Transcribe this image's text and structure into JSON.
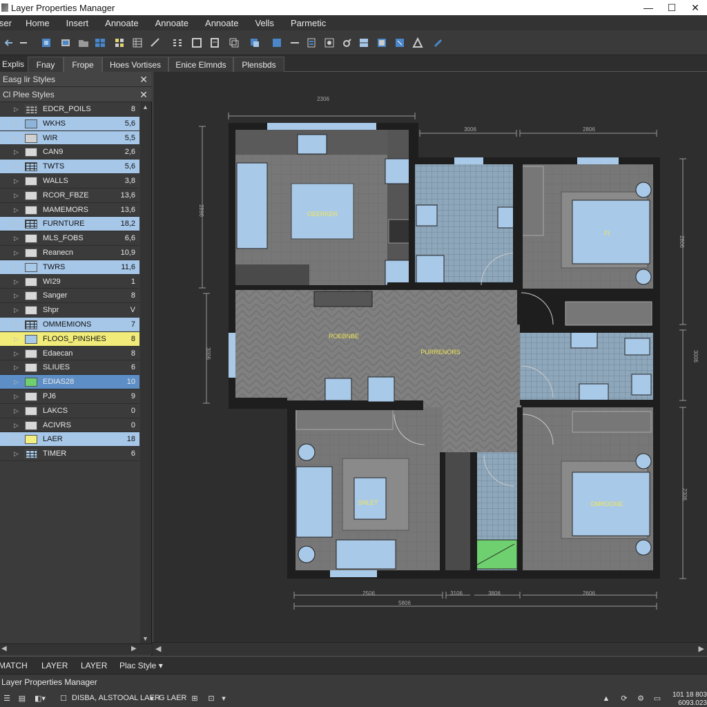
{
  "window": {
    "title": "Layer Properties Manager",
    "controls": [
      "—",
      "☐",
      "✕"
    ]
  },
  "menu": [
    "iser",
    "Home",
    "Insert",
    "Annoate",
    "Annoate",
    "Annoate",
    "Vells",
    "Parmetic"
  ],
  "tabs": [
    "Explis",
    "Fnay",
    "Frope",
    "Hoes Vortises",
    "Enice Elmnds",
    "Plensbds"
  ],
  "sidebar": {
    "header1": "Easg lir Styles",
    "header2": "Cl Plee Styles",
    "layers": [
      {
        "name": "EDCR_POILS",
        "value": "8",
        "style": "normal",
        "swatch": "grid",
        "color": "#9a9a9a"
      },
      {
        "name": "WKHS",
        "value": "5,6",
        "style": "blue",
        "swatch": "plain",
        "color": "#8fb4d9"
      },
      {
        "name": "WIR",
        "value": "5,5",
        "style": "blue",
        "swatch": "plain",
        "color": "#d0d0d0"
      },
      {
        "name": "CAN9",
        "value": "2,6",
        "style": "normal",
        "swatch": "plain",
        "color": "#d8d8d8"
      },
      {
        "name": "TWTS",
        "value": "5,6",
        "style": "blue",
        "swatch": "grid",
        "color": "#a9c9e8"
      },
      {
        "name": "WALLS",
        "value": "3,8",
        "style": "normal",
        "swatch": "plain",
        "color": "#d8d8d8"
      },
      {
        "name": "RCOR_FBZE",
        "value": "13,6",
        "style": "normal",
        "swatch": "plain",
        "color": "#d8d8d8"
      },
      {
        "name": "MAMEMORS",
        "value": "13,6",
        "style": "normal",
        "swatch": "plain",
        "color": "#d8d8d8"
      },
      {
        "name": "FURNTURE",
        "value": "18,2",
        "style": "blue",
        "swatch": "grid",
        "color": "#a9c9e8"
      },
      {
        "name": "MLS_FOBS",
        "value": "6,6",
        "style": "normal",
        "swatch": "plain",
        "color": "#d8d8d8"
      },
      {
        "name": "Reanecn",
        "value": "10,9",
        "style": "normal",
        "swatch": "plain",
        "color": "#d8d8d8"
      },
      {
        "name": "TWRS",
        "value": "11,6",
        "style": "blue",
        "swatch": "plain",
        "color": "#a9c9e8"
      },
      {
        "name": "WI29",
        "value": "1",
        "style": "normal",
        "swatch": "plain",
        "color": "#d8d8d8"
      },
      {
        "name": "Sanger",
        "value": "8",
        "style": "normal",
        "swatch": "plain",
        "color": "#d8d8d8"
      },
      {
        "name": "Shpr",
        "value": "V",
        "style": "normal",
        "swatch": "plain",
        "color": "#d8d8d8"
      },
      {
        "name": "OMMEMIONS",
        "value": "7",
        "style": "blue",
        "swatch": "grid",
        "color": "#a9c9e8"
      },
      {
        "name": "FLOOS_PINSHES",
        "value": "8",
        "style": "yellow",
        "swatch": "plain",
        "color": "#a9c9e8"
      },
      {
        "name": "Edaecan",
        "value": "8",
        "style": "normal",
        "swatch": "plain",
        "color": "#d8d8d8"
      },
      {
        "name": "SLIUES",
        "value": "6",
        "style": "normal",
        "swatch": "plain",
        "color": "#d8d8d8"
      },
      {
        "name": "EDIAS28",
        "value": "10",
        "style": "dblue",
        "swatch": "plain",
        "color": "#6fd06f"
      },
      {
        "name": "PJ6",
        "value": "9",
        "style": "normal",
        "swatch": "plain",
        "color": "#d8d8d8"
      },
      {
        "name": "LAKCS",
        "value": "0",
        "style": "normal",
        "swatch": "plain",
        "color": "#d8d8d8"
      },
      {
        "name": "ACIVRS",
        "value": "0",
        "style": "normal",
        "swatch": "plain",
        "color": "#d8d8d8"
      },
      {
        "name": "LAER",
        "value": "18",
        "style": "blue",
        "swatch": "plain",
        "color": "#f2ee80"
      },
      {
        "name": "TIMER",
        "value": "6",
        "style": "normal",
        "swatch": "grid",
        "color": "#a9c9e8"
      }
    ]
  },
  "plan": {
    "room_labels": [
      "OEERKER",
      "FI",
      "ROEBNBE",
      "PURRENORS",
      "SNLET",
      "DMRDONE"
    ],
    "dimensions": [
      "2306",
      "3006",
      "2806",
      "2506",
      "3106",
      "3806",
      "2606",
      "5806",
      "3806"
    ],
    "side_dims": [
      "2896",
      "3006",
      "2806",
      "3006",
      "2306"
    ]
  },
  "command_bar": [
    "MATCH",
    "LAYER",
    "LAYER",
    "Plac Style"
  ],
  "status": {
    "label": "Layer Properties Manager",
    "text1": "DISBA, ALSTOOAL LAER",
    "text2": "G LAER",
    "coords": [
      "101 18 803",
      "6093.023"
    ]
  },
  "colors": {
    "highlight_blue": "#a7c7e8",
    "highlight_yellow": "#f1ec7a",
    "selected_blue": "#5d8fc6",
    "plan_wall": "#1e1e1e",
    "plan_floor": "#7a7a7a",
    "furniture_blue": "#a9c9e8"
  }
}
